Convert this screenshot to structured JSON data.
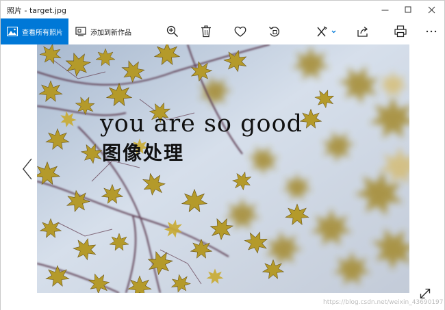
{
  "window": {
    "title": "照片 - target.jpg"
  },
  "titlebar_buttons": [
    {
      "name": "minimize-button",
      "icon": "minimize-icon"
    },
    {
      "name": "maximize-button",
      "icon": "maximize-icon"
    },
    {
      "name": "close-button",
      "icon": "close-icon"
    }
  ],
  "toolbar": {
    "view_all_label": "查看所有照片",
    "add_work_label": "添加到新作品",
    "icons": [
      "zoom-in-icon",
      "delete-icon",
      "favorite-heart-icon",
      "rotate-icon",
      "edit-draw-icon",
      "share-icon",
      "print-icon",
      "more-icon"
    ],
    "accent_color": "#0078d7"
  },
  "photo": {
    "overlay_text_en": "you are so good",
    "overlay_text_cn": "图像处理"
  },
  "watermark": "https://blog.csdn.net/weixin_43690197"
}
